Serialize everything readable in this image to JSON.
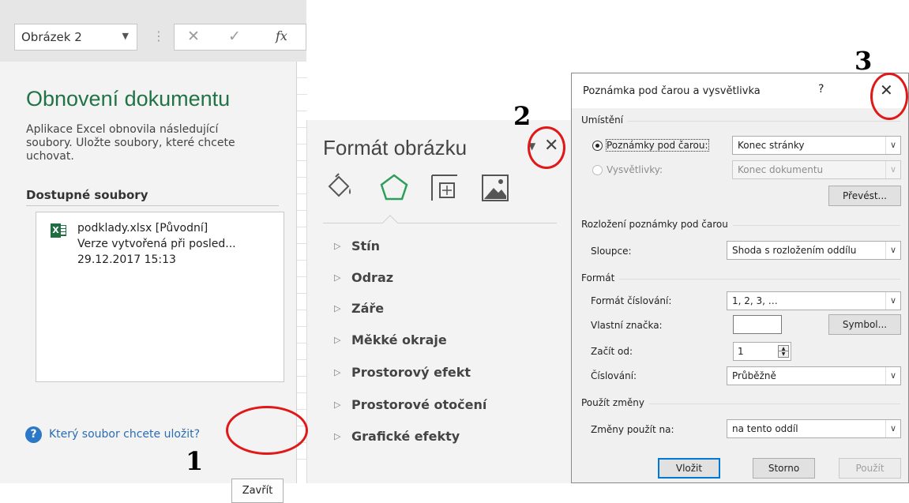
{
  "excel": {
    "namebox_value": "Obrázek 2",
    "fx_label": "fx",
    "recovery": {
      "title": "Obnovení dokumentu",
      "description": "Aplikace Excel obnovila následující soubory. Uložte soubory, které chcete uchovat.",
      "available_heading": "Dostupné soubory",
      "files": [
        {
          "name_line": "podklady.xlsx  [Původní]",
          "version_line": "Verze vytvořená při posled...",
          "date_line": "29.12.2017 15:13"
        }
      ],
      "help_link": "Který soubor chcete uložit?",
      "close_button": "Zavřít"
    }
  },
  "format_pane": {
    "title": "Formát obrázku",
    "tabs": [
      "fill-line",
      "effects",
      "size-properties",
      "picture"
    ],
    "sections": [
      "Stín",
      "Odraz",
      "Záře",
      "Měkké okraje",
      "Prostorový efekt",
      "Prostorové otočení",
      "Grafické efekty"
    ]
  },
  "dialog": {
    "title": "Poznámka pod čarou a vysvětlivka",
    "help": "?",
    "placement_group": "Umístění",
    "footnotes_label": "Poznámky pod čarou:",
    "footnotes_value": "Konec stránky",
    "endnotes_label": "Vysvětlivky:",
    "endnotes_value": "Konec dokumentu",
    "convert_button": "Převést...",
    "layout_group": "Rozložení poznámky pod čarou",
    "columns_label": "Sloupce:",
    "columns_value": "Shoda s rozložením oddílu",
    "format_group": "Formát",
    "number_format_label": "Formát číslování:",
    "number_format_value": "1, 2, 3, …",
    "custom_mark_label": "Vlastní značka:",
    "custom_mark_value": "",
    "symbol_button": "Symbol...",
    "start_at_label": "Začít od:",
    "start_at_value": "1",
    "numbering_label": "Číslování:",
    "numbering_value": "Průběžně",
    "apply_group": "Použít změny",
    "apply_to_label": "Změny použít na:",
    "apply_to_value": "na tento oddíl",
    "insert_button": "Vložit",
    "cancel_button": "Storno",
    "apply_button": "Použít"
  },
  "annotations": {
    "marker_1": "1",
    "marker_2": "2",
    "marker_3": "3",
    "highlight_color": "#e01818"
  }
}
